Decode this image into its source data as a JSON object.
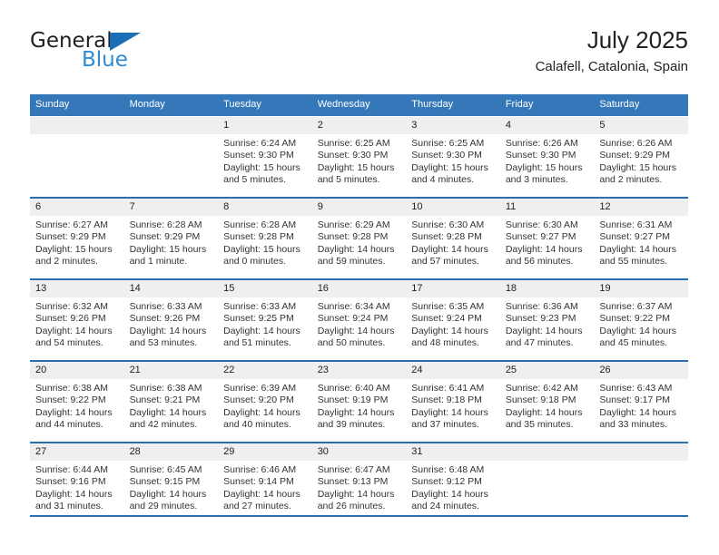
{
  "brand": {
    "name_part1": "General",
    "name_part2": "Blue",
    "triangle_icon": "brand-triangle-icon",
    "color_dark": "#231f20",
    "color_blue": "#2e8bd4"
  },
  "header": {
    "title": "July 2025",
    "subtitle": "Calafell, Catalonia, Spain"
  },
  "theme": {
    "header_blue": "#3578b9",
    "rule_blue": "#2a6db0",
    "band_gray": "#efefef"
  },
  "calendar": {
    "weekday_headers": [
      "Sunday",
      "Monday",
      "Tuesday",
      "Wednesday",
      "Thursday",
      "Friday",
      "Saturday"
    ],
    "weeks": [
      [
        {
          "day": "",
          "empty": true,
          "sunrise": "",
          "sunset": "",
          "daylight1": "",
          "daylight2": ""
        },
        {
          "day": "",
          "empty": true,
          "sunrise": "",
          "sunset": "",
          "daylight1": "",
          "daylight2": ""
        },
        {
          "day": "1",
          "sunrise": "Sunrise: 6:24 AM",
          "sunset": "Sunset: 9:30 PM",
          "daylight1": "Daylight: 15 hours",
          "daylight2": "and 5 minutes."
        },
        {
          "day": "2",
          "sunrise": "Sunrise: 6:25 AM",
          "sunset": "Sunset: 9:30 PM",
          "daylight1": "Daylight: 15 hours",
          "daylight2": "and 5 minutes."
        },
        {
          "day": "3",
          "sunrise": "Sunrise: 6:25 AM",
          "sunset": "Sunset: 9:30 PM",
          "daylight1": "Daylight: 15 hours",
          "daylight2": "and 4 minutes."
        },
        {
          "day": "4",
          "sunrise": "Sunrise: 6:26 AM",
          "sunset": "Sunset: 9:30 PM",
          "daylight1": "Daylight: 15 hours",
          "daylight2": "and 3 minutes."
        },
        {
          "day": "5",
          "sunrise": "Sunrise: 6:26 AM",
          "sunset": "Sunset: 9:29 PM",
          "daylight1": "Daylight: 15 hours",
          "daylight2": "and 2 minutes."
        }
      ],
      [
        {
          "day": "6",
          "sunrise": "Sunrise: 6:27 AM",
          "sunset": "Sunset: 9:29 PM",
          "daylight1": "Daylight: 15 hours",
          "daylight2": "and 2 minutes."
        },
        {
          "day": "7",
          "sunrise": "Sunrise: 6:28 AM",
          "sunset": "Sunset: 9:29 PM",
          "daylight1": "Daylight: 15 hours",
          "daylight2": "and 1 minute."
        },
        {
          "day": "8",
          "sunrise": "Sunrise: 6:28 AM",
          "sunset": "Sunset: 9:28 PM",
          "daylight1": "Daylight: 15 hours",
          "daylight2": "and 0 minutes."
        },
        {
          "day": "9",
          "sunrise": "Sunrise: 6:29 AM",
          "sunset": "Sunset: 9:28 PM",
          "daylight1": "Daylight: 14 hours",
          "daylight2": "and 59 minutes."
        },
        {
          "day": "10",
          "sunrise": "Sunrise: 6:30 AM",
          "sunset": "Sunset: 9:28 PM",
          "daylight1": "Daylight: 14 hours",
          "daylight2": "and 57 minutes."
        },
        {
          "day": "11",
          "sunrise": "Sunrise: 6:30 AM",
          "sunset": "Sunset: 9:27 PM",
          "daylight1": "Daylight: 14 hours",
          "daylight2": "and 56 minutes."
        },
        {
          "day": "12",
          "sunrise": "Sunrise: 6:31 AM",
          "sunset": "Sunset: 9:27 PM",
          "daylight1": "Daylight: 14 hours",
          "daylight2": "and 55 minutes."
        }
      ],
      [
        {
          "day": "13",
          "sunrise": "Sunrise: 6:32 AM",
          "sunset": "Sunset: 9:26 PM",
          "daylight1": "Daylight: 14 hours",
          "daylight2": "and 54 minutes."
        },
        {
          "day": "14",
          "sunrise": "Sunrise: 6:33 AM",
          "sunset": "Sunset: 9:26 PM",
          "daylight1": "Daylight: 14 hours",
          "daylight2": "and 53 minutes."
        },
        {
          "day": "15",
          "sunrise": "Sunrise: 6:33 AM",
          "sunset": "Sunset: 9:25 PM",
          "daylight1": "Daylight: 14 hours",
          "daylight2": "and 51 minutes."
        },
        {
          "day": "16",
          "sunrise": "Sunrise: 6:34 AM",
          "sunset": "Sunset: 9:24 PM",
          "daylight1": "Daylight: 14 hours",
          "daylight2": "and 50 minutes."
        },
        {
          "day": "17",
          "sunrise": "Sunrise: 6:35 AM",
          "sunset": "Sunset: 9:24 PM",
          "daylight1": "Daylight: 14 hours",
          "daylight2": "and 48 minutes."
        },
        {
          "day": "18",
          "sunrise": "Sunrise: 6:36 AM",
          "sunset": "Sunset: 9:23 PM",
          "daylight1": "Daylight: 14 hours",
          "daylight2": "and 47 minutes."
        },
        {
          "day": "19",
          "sunrise": "Sunrise: 6:37 AM",
          "sunset": "Sunset: 9:22 PM",
          "daylight1": "Daylight: 14 hours",
          "daylight2": "and 45 minutes."
        }
      ],
      [
        {
          "day": "20",
          "sunrise": "Sunrise: 6:38 AM",
          "sunset": "Sunset: 9:22 PM",
          "daylight1": "Daylight: 14 hours",
          "daylight2": "and 44 minutes."
        },
        {
          "day": "21",
          "sunrise": "Sunrise: 6:38 AM",
          "sunset": "Sunset: 9:21 PM",
          "daylight1": "Daylight: 14 hours",
          "daylight2": "and 42 minutes."
        },
        {
          "day": "22",
          "sunrise": "Sunrise: 6:39 AM",
          "sunset": "Sunset: 9:20 PM",
          "daylight1": "Daylight: 14 hours",
          "daylight2": "and 40 minutes."
        },
        {
          "day": "23",
          "sunrise": "Sunrise: 6:40 AM",
          "sunset": "Sunset: 9:19 PM",
          "daylight1": "Daylight: 14 hours",
          "daylight2": "and 39 minutes."
        },
        {
          "day": "24",
          "sunrise": "Sunrise: 6:41 AM",
          "sunset": "Sunset: 9:18 PM",
          "daylight1": "Daylight: 14 hours",
          "daylight2": "and 37 minutes."
        },
        {
          "day": "25",
          "sunrise": "Sunrise: 6:42 AM",
          "sunset": "Sunset: 9:18 PM",
          "daylight1": "Daylight: 14 hours",
          "daylight2": "and 35 minutes."
        },
        {
          "day": "26",
          "sunrise": "Sunrise: 6:43 AM",
          "sunset": "Sunset: 9:17 PM",
          "daylight1": "Daylight: 14 hours",
          "daylight2": "and 33 minutes."
        }
      ],
      [
        {
          "day": "27",
          "sunrise": "Sunrise: 6:44 AM",
          "sunset": "Sunset: 9:16 PM",
          "daylight1": "Daylight: 14 hours",
          "daylight2": "and 31 minutes."
        },
        {
          "day": "28",
          "sunrise": "Sunrise: 6:45 AM",
          "sunset": "Sunset: 9:15 PM",
          "daylight1": "Daylight: 14 hours",
          "daylight2": "and 29 minutes."
        },
        {
          "day": "29",
          "sunrise": "Sunrise: 6:46 AM",
          "sunset": "Sunset: 9:14 PM",
          "daylight1": "Daylight: 14 hours",
          "daylight2": "and 27 minutes."
        },
        {
          "day": "30",
          "sunrise": "Sunrise: 6:47 AM",
          "sunset": "Sunset: 9:13 PM",
          "daylight1": "Daylight: 14 hours",
          "daylight2": "and 26 minutes."
        },
        {
          "day": "31",
          "sunrise": "Sunrise: 6:48 AM",
          "sunset": "Sunset: 9:12 PM",
          "daylight1": "Daylight: 14 hours",
          "daylight2": "and 24 minutes."
        },
        {
          "day": "",
          "empty": true,
          "sunrise": "",
          "sunset": "",
          "daylight1": "",
          "daylight2": ""
        },
        {
          "day": "",
          "empty": true,
          "sunrise": "",
          "sunset": "",
          "daylight1": "",
          "daylight2": ""
        }
      ]
    ]
  }
}
